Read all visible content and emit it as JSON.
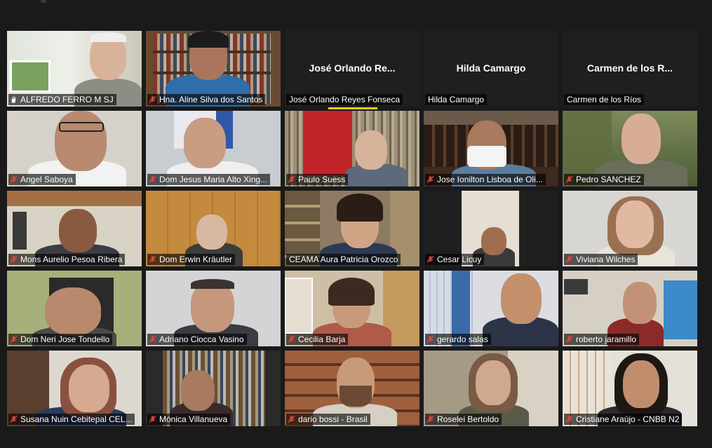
{
  "meeting": {
    "tiles": [
      {
        "name": "ALFREDO FERRO M SJ",
        "muted": false,
        "hand_icon": true,
        "active_speaker": true,
        "video": true
      },
      {
        "name": "Hna. Aline Silva dos Santos",
        "muted": true,
        "video": true
      },
      {
        "name": "José Orlando Reyes Fonseca",
        "display_title": "José Orlando Re...",
        "muted": false,
        "video": false
      },
      {
        "name": "Hilda Camargo",
        "display_title": "Hilda Camargo",
        "muted": false,
        "video": false
      },
      {
        "name": "Carmen de los Ríos",
        "display_title": "Carmen de los R...",
        "muted": false,
        "video": false
      },
      {
        "name": "Angel Saboya",
        "muted": true,
        "video": true
      },
      {
        "name": "Dom Jesus Maria Alto Xing...",
        "muted": true,
        "video": true
      },
      {
        "name": "Paulo Suess",
        "muted": true,
        "video": true
      },
      {
        "name": "Jose Ionilton Lisboa de Oli...",
        "muted": true,
        "video": true
      },
      {
        "name": "Pedro SANCHEZ",
        "muted": true,
        "video": true
      },
      {
        "name": "Mons Aurelio Pesoa Ribera",
        "muted": true,
        "video": true
      },
      {
        "name": "Dom Erwin Kräutler",
        "muted": true,
        "video": true
      },
      {
        "name": "CEAMA Aura Patricia Orozco",
        "muted": false,
        "video": true
      },
      {
        "name": "Cesar Licuy",
        "muted": true,
        "video": true
      },
      {
        "name": "Viviana Wilches",
        "muted": true,
        "video": true
      },
      {
        "name": "Dom Neri Jose Tondello",
        "muted": true,
        "video": true
      },
      {
        "name": "Adriano Ciocca Vasino",
        "muted": true,
        "video": true
      },
      {
        "name": "Cecilia Barja",
        "muted": true,
        "video": true
      },
      {
        "name": "gerardo salas",
        "muted": true,
        "video": true
      },
      {
        "name": "roberto jaramillo",
        "muted": true,
        "video": true
      },
      {
        "name": "Susana Nuin Cebitepal CEL...",
        "muted": true,
        "video": true
      },
      {
        "name": "Mónica Villanueva",
        "muted": true,
        "video": true
      },
      {
        "name": "dario bossi - Brasil",
        "muted": true,
        "video": true
      },
      {
        "name": "Roselei Bertoldo",
        "muted": true,
        "video": true
      },
      {
        "name": "Cristiane Araújo - CNBB N2",
        "muted": true,
        "video": true
      }
    ]
  },
  "colors": {
    "background": "#1a1a1a",
    "active_speaker_border": "#b9d96b",
    "muted_icon": "#e0433a",
    "speaking_indicator": "#f0d000"
  }
}
